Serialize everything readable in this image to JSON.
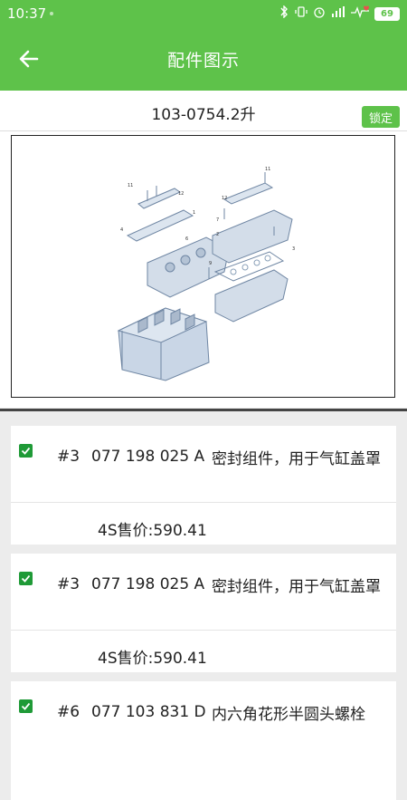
{
  "status_bar": {
    "time": "10:37",
    "battery": "69"
  },
  "header": {
    "title": "配件图示"
  },
  "subheader": {
    "model": "103-0754.2升",
    "lock_label": "锁定"
  },
  "colors": {
    "brand_green": "#5ec24a",
    "check_green": "#1f9a37"
  },
  "parts": [
    {
      "position": "#3",
      "part_number": "077 198 025 A",
      "description": "密封组件，用于气缸盖罩",
      "price": "4S售价:590.41",
      "checked": true
    },
    {
      "position": "#3",
      "part_number": "077 198 025 A",
      "description": "密封组件，用于气缸盖罩",
      "price": "4S售价:590.41",
      "checked": true
    },
    {
      "position": "#6",
      "part_number": "077 103 831 D",
      "description": "内六角花形半圆头螺栓",
      "price": "",
      "checked": true
    }
  ]
}
